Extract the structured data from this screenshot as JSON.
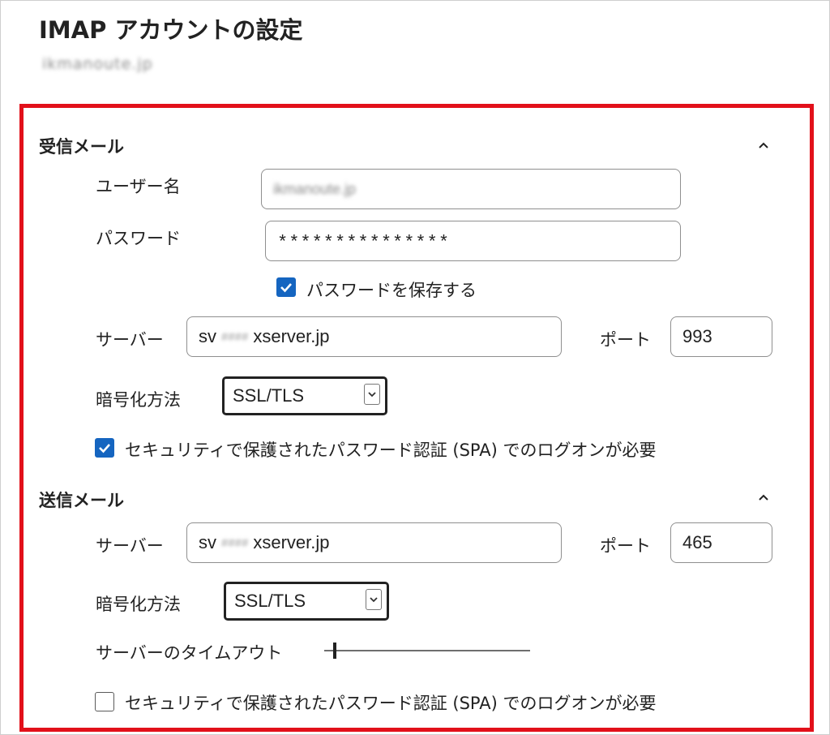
{
  "header": {
    "title": "IMAP アカウントの設定",
    "account": "ikmanoute.jp"
  },
  "incoming": {
    "section_title": "受信メール",
    "username_label": "ユーザー名",
    "username_value": "ikmanoute.jp",
    "password_label": "パスワード",
    "password_value": "***************",
    "save_password_label": "パスワードを保存する",
    "save_password_checked": true,
    "server_label": "サーバー",
    "server_prefix": "sv",
    "server_hidden": "####",
    "server_suffix": "xserver.jp",
    "port_label": "ポート",
    "port_value": "993",
    "encryption_label": "暗号化方法",
    "encryption_value": "SSL/TLS",
    "spa_label": "セキュリティで保護されたパスワード認証 (SPA) でのログオンが必要",
    "spa_checked": true
  },
  "outgoing": {
    "section_title": "送信メール",
    "server_label": "サーバー",
    "server_prefix": "sv",
    "server_hidden": "####",
    "server_suffix": "xserver.jp",
    "port_label": "ポート",
    "port_value": "465",
    "encryption_label": "暗号化方法",
    "encryption_value": "SSL/TLS",
    "timeout_label": "サーバーのタイムアウト",
    "timeout_level": 0.05,
    "spa_label": "セキュリティで保護されたパスワード認証 (SPA) でのログオンが必要",
    "spa_checked": false
  },
  "colors": {
    "highlight_border": "#e2101a",
    "checkbox_accent": "#1565c0"
  },
  "icons": {
    "collapse": "chevron-up-icon",
    "dropdown": "chevron-down-icon",
    "check": "checkmark-icon"
  }
}
